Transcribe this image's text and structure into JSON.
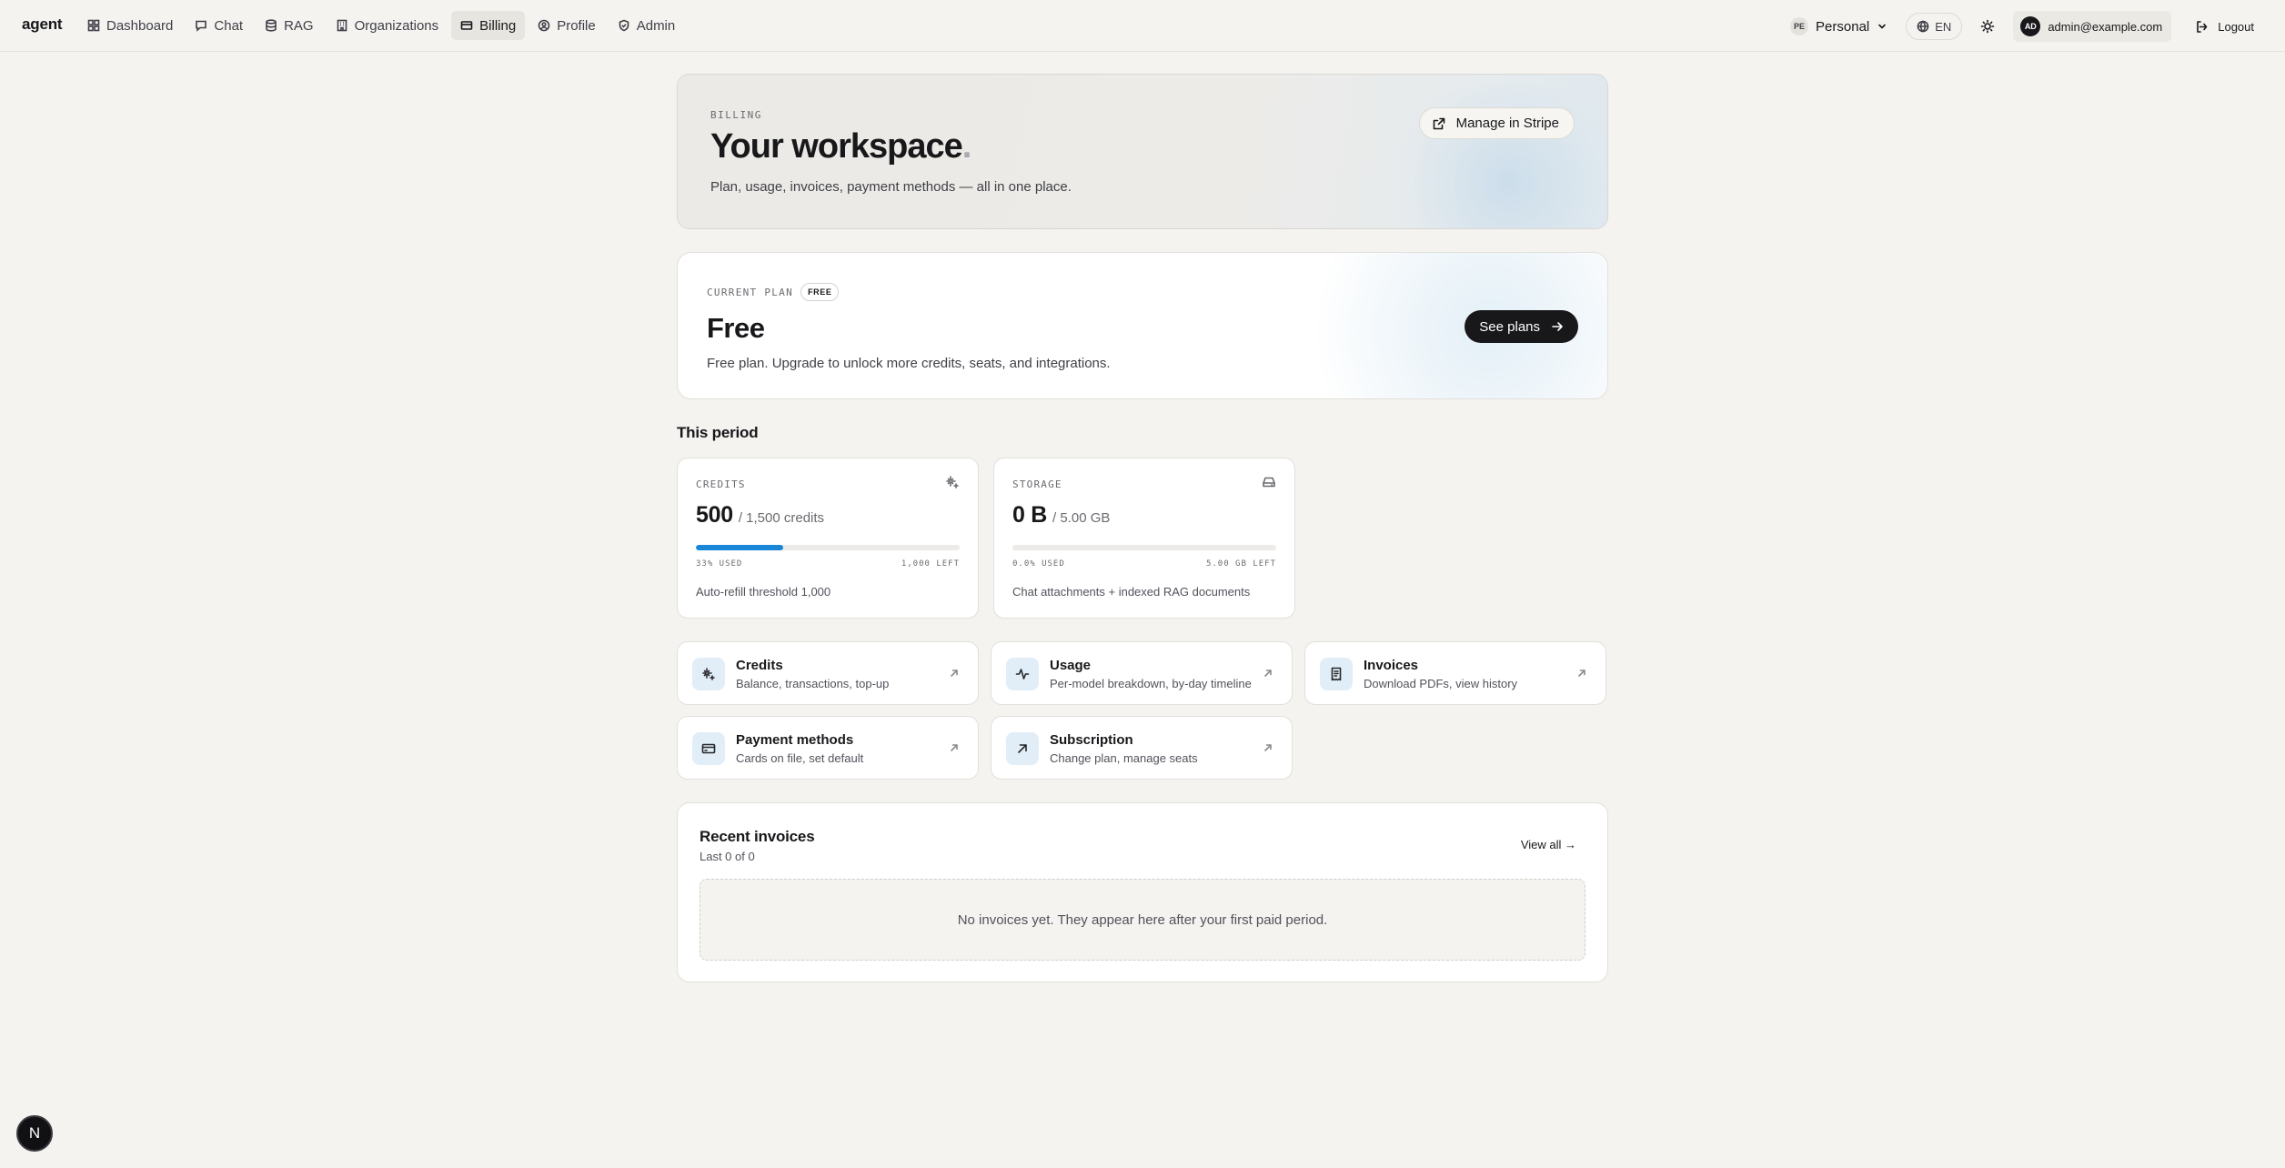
{
  "nav": {
    "brand": "agent",
    "items": [
      {
        "label": "Dashboard",
        "icon": "grid-icon"
      },
      {
        "label": "Chat",
        "icon": "chat-icon"
      },
      {
        "label": "RAG",
        "icon": "database-icon"
      },
      {
        "label": "Organizations",
        "icon": "building-icon"
      },
      {
        "label": "Billing",
        "icon": "card-icon",
        "active": true
      },
      {
        "label": "Profile",
        "icon": "user-circle-icon"
      },
      {
        "label": "Admin",
        "icon": "shield-icon"
      }
    ],
    "workspace": {
      "initials": "PE",
      "label": "Personal"
    },
    "language": "EN",
    "user": {
      "initials": "AD",
      "email": "admin@example.com"
    },
    "logout_label": "Logout"
  },
  "hero": {
    "eyebrow": "BILLING",
    "title": "Your workspace",
    "title_suffix": ".",
    "subtitle": "Plan, usage, invoices, payment methods — all in one place.",
    "stripe_button": "Manage in Stripe"
  },
  "plan": {
    "label": "CURRENT PLAN",
    "badge": "FREE",
    "name": "Free",
    "description": "Free plan. Upgrade to unlock more credits, seats, and integrations.",
    "cta": "See plans"
  },
  "period": {
    "title": "This period",
    "credits": {
      "label": "CREDITS",
      "value": "500",
      "of": "/ 1,500 credits",
      "used_fraction": 0.33,
      "used_label": "33% USED",
      "left_label": "1,000 LEFT",
      "footnote": "Auto-refill threshold 1,000"
    },
    "storage": {
      "label": "STORAGE",
      "value": "0 B",
      "of": "/ 5.00 GB",
      "used_fraction": 0,
      "used_label": "0.0% USED",
      "left_label": "5.00 GB LEFT",
      "footnote": "Chat attachments + indexed RAG documents"
    }
  },
  "links": [
    {
      "title": "Credits",
      "subtitle": "Balance, transactions, top-up",
      "icon": "sparkle-icon"
    },
    {
      "title": "Usage",
      "subtitle": "Per-model breakdown, by-day timeline",
      "icon": "activity-icon"
    },
    {
      "title": "Invoices",
      "subtitle": "Download PDFs, view history",
      "icon": "receipt-icon"
    },
    {
      "title": "Payment methods",
      "subtitle": "Cards on file, set default",
      "icon": "credit-card-icon"
    },
    {
      "title": "Subscription",
      "subtitle": "Change plan, manage seats",
      "icon": "arrow-up-right-icon"
    }
  ],
  "invoices": {
    "title": "Recent invoices",
    "subtitle": "Last 0 of 0",
    "view_all": "View all →",
    "empty": "No invoices yet. They appear here after your first paid period."
  },
  "corner_badge": "N",
  "colors": {
    "accent": "#1a86d8",
    "background": "#f4f3f0",
    "dark": "#18181b",
    "icon_tile": "#e1eef8"
  }
}
